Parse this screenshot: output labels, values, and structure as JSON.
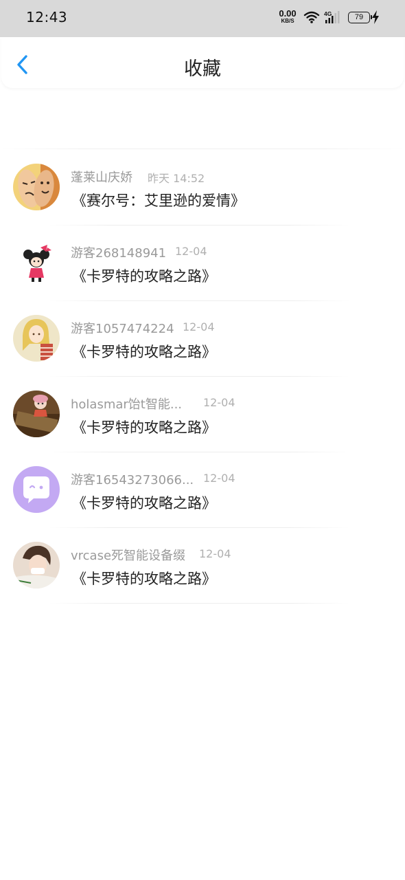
{
  "status_bar": {
    "time": "12:43",
    "net_speed_value": "0.00",
    "net_speed_unit": "KB/S",
    "network_type": "4G",
    "battery": "79",
    "icons": [
      "wifi-icon",
      "signal-4g-icon",
      "battery-icon",
      "charging-icon"
    ]
  },
  "header": {
    "title": "收藏",
    "back_icon": "chevron-left-icon",
    "accent": "#2196f3"
  },
  "favorites": [
    {
      "user": "蓬莱山庆娇",
      "time": "昨天 14:52",
      "title": "《赛尔号：艾里逊的爱情》"
    },
    {
      "user": "游客268148941",
      "time": "12-04",
      "title": "《卡罗特的攻略之路》"
    },
    {
      "user": "游客1057474224",
      "time": "12-04",
      "title": "《卡罗特的攻略之路》"
    },
    {
      "user": "holasmar饴t智能...",
      "time": "12-04",
      "title": "《卡罗特的攻略之路》"
    },
    {
      "user": "游客16543273066...",
      "time": "12-04",
      "title": "《卡罗特的攻略之路》"
    },
    {
      "user": "vrcase死智能设备缀",
      "time": "12-04",
      "title": "《卡罗特的攻略之路》"
    }
  ]
}
